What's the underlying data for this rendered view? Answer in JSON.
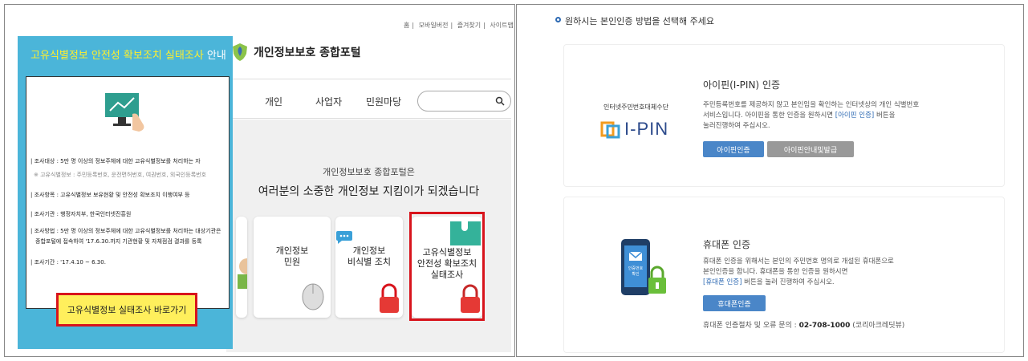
{
  "left": {
    "top_links": [
      "홈",
      "모바일버전",
      "즐겨찾기",
      "사이트맵"
    ],
    "logo_title": "개인정보보호 종합포털",
    "nav": [
      "개인",
      "사업자",
      "민원마당"
    ],
    "hero_line1": "개인정보보호 종합포털은",
    "hero_line2": "여러분의 소중한 개인정보 지킴이가 되겠습니다",
    "cards": [
      {
        "label": "개인정보\n민원"
      },
      {
        "label": "개인정보\n비식별 조치"
      },
      {
        "label": "고유식별정보\n안전성 확보조치\n실태조사"
      }
    ],
    "popup": {
      "title_main": "고유식별정보 안전성 확보조치 실태조사",
      "title_suffix": "안내",
      "lines": [
        "| 조사대상 : 5만 명 이상의 정보주체에 대한 고유식별정보를 처리하는 자",
        "| 조사항목 : 고유식별정보 보유현황 및 안전성 확보조치 이행여부 등",
        "| 조사기관 : 행정자치부, 한국인터넷진흥원",
        "| 조사방법 : 5만 명 이상의 정보주체에 대한 고유식별정보를 처리하는 대상기관은",
        "종합포털에 접속하여 '17.6.30.까지 기관현황 및 자체점검 결과를 등록",
        "| 조사기간 : '17.4.10 ~ 6.30."
      ],
      "sub_line": "※ 고유식별정보 : 주민등록번호, 운전면허번호, 여권번호, 외국인등록번호",
      "button": "고유식별정보 실태조사 바로가기"
    }
  },
  "right": {
    "heading": "원하시는 본인인증 방법을 선택해 주세요",
    "ipin": {
      "caption": "인터넷주민번호대체수단",
      "logo_text": "I-PIN",
      "title": "아이핀(I-PIN) 인증",
      "desc_1": "주민등록번호를 제공하지 않고 본인임을 확인하는 인터넷상의 개인 식별번호",
      "desc_2": "서비스입니다. 아이핀을 통한 인증을 원하시면",
      "desc_link": "[아이핀 인증]",
      "desc_3": "버튼을",
      "desc_4": "눌러진행하여 주십시오.",
      "btn_auth": "아이핀인증",
      "btn_info": "아이핀안내및발급"
    },
    "phone": {
      "icon_text": "인증번호\n확인",
      "title": "휴대폰 인증",
      "desc_1": "휴대폰 인증을 위해서는 본인의 주민번호 명의로 개설된 휴대폰으로",
      "desc_2": "본인인증을 합니다. 휴대폰을 통한 인증을 원하시면",
      "desc_link": "[휴대폰 인증]",
      "desc_3": "버튼을 눌러 진행하여 주십시오.",
      "btn_auth": "휴대폰인증",
      "contact_label": "휴대폰 인증절차 및 오류 문의 :",
      "contact_phone": "02-708-1000",
      "contact_org": "(코리아크레딧뷰)"
    }
  },
  "colors": {
    "popup_bg": "#4bb5d9",
    "popup_title": "#ffef2c",
    "highlight": "#d8141c",
    "button_blue": "#4a86c8"
  }
}
